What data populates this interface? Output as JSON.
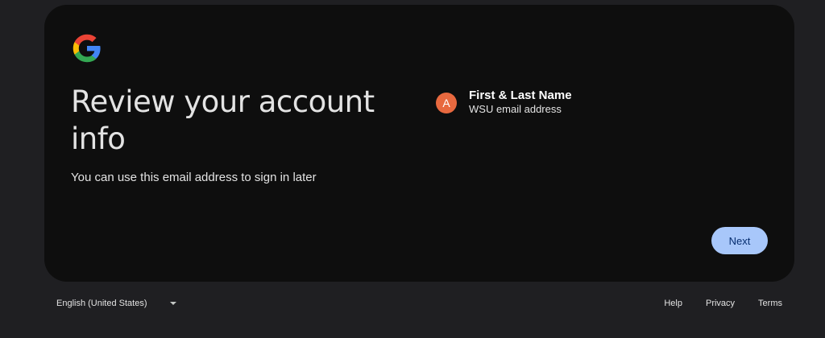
{
  "card": {
    "logo_icon": "google-g-icon",
    "headline": "Review your account info",
    "subtext": "You can use this email address to sign in later",
    "account": {
      "avatar_letter": "A",
      "avatar_color": "#e8693f",
      "name": "First & Last Name",
      "email": "WSU email address"
    },
    "next_label": "Next"
  },
  "footer": {
    "language": "English (United States)",
    "links": [
      "Help",
      "Privacy",
      "Terms"
    ]
  },
  "colors": {
    "page_background": "#1f1f22",
    "card_background": "#0e0e0e",
    "accent": "#a8c7fa",
    "accent_text": "#062e6f"
  }
}
